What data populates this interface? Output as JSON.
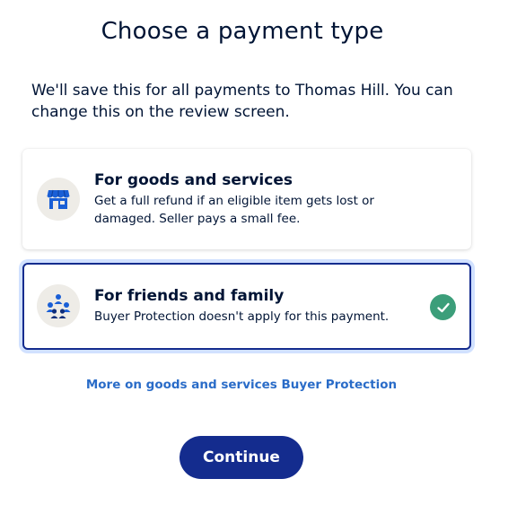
{
  "header": {
    "title": "Choose a payment type"
  },
  "intro": {
    "text": "We'll save this for all payments to Thomas Hill. You can change this on the review screen."
  },
  "options": [
    {
      "title": "For goods and services",
      "description": "Get a full refund if an eligible item gets lost or damaged. Seller pays a small fee.",
      "icon": "storefront-icon",
      "selected": false
    },
    {
      "title": "For friends and family",
      "description": "Buyer Protection doesn't apply for this payment.",
      "icon": "people-group-icon",
      "selected": true
    }
  ],
  "link": {
    "label": "More on goods and services Buyer Protection"
  },
  "actions": {
    "continue_label": "Continue"
  },
  "colors": {
    "primary": "#142c8e",
    "selected_ring": "#d1e1ff",
    "check": "#3c9e7a",
    "link": "#2a6cc8",
    "icon_bg": "#eeece7",
    "icon_blue": "#1a5fd6"
  }
}
